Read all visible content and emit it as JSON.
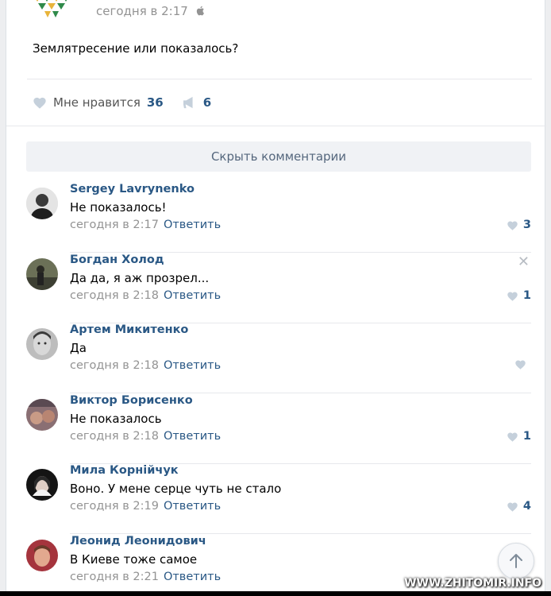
{
  "post": {
    "time": "сегодня в 2:17",
    "text": "Землятресение или показалось?",
    "like_label": "Мне нравится",
    "like_count": "36",
    "share_count": "6"
  },
  "comments_toggle": "Скрыть комментарии",
  "reply_label": "Ответить",
  "comments": [
    {
      "name": "Sergey Lavrynenko",
      "text": "Не показалось!",
      "time": "сегодня в 2:17",
      "likes": "3"
    },
    {
      "name": "Богдан Холод",
      "text": "Да да, я аж прозрел...",
      "time": "сегодня в 2:18",
      "likes": "1"
    },
    {
      "name": "Артем Микитенко",
      "text": "Да",
      "time": "сегодня в 2:18",
      "likes": ""
    },
    {
      "name": "Виктор Борисенко",
      "text": "Не показалось",
      "time": "сегодня в 2:18",
      "likes": "1"
    },
    {
      "name": "Мила Корнійчук",
      "text": "Воно. У мене серце чуть не стало",
      "time": "сегодня в 2:19",
      "likes": "4"
    },
    {
      "name": "Леонид Леонидович",
      "text": "В Киеве тоже самое",
      "time": "сегодня в 2:21",
      "likes": ""
    }
  ],
  "watermark": "WWW.ZHITOMIR.INFO",
  "colors": {
    "link": "#2a5885",
    "meta": "#939393",
    "like_icon": "#c5d0db",
    "background": "#edeef0"
  }
}
